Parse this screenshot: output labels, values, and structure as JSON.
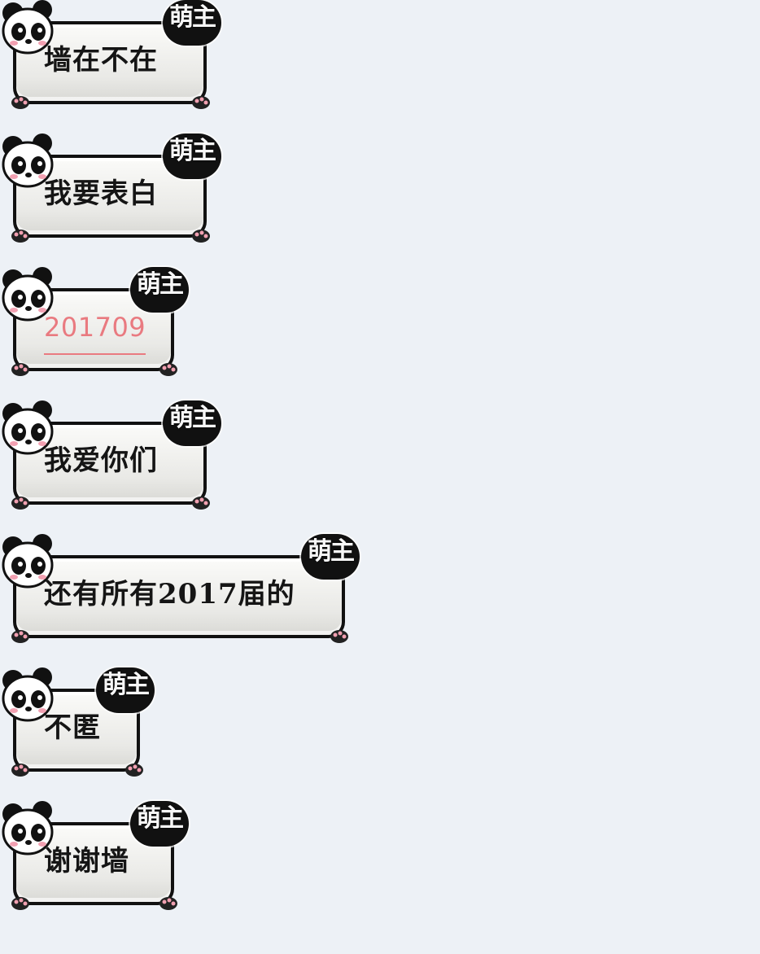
{
  "chat": {
    "badge_label": "萌主",
    "messages": [
      {
        "text": "墙在不在",
        "type": "text"
      },
      {
        "text": "我要表白",
        "type": "text"
      },
      {
        "text": "201709",
        "type": "link"
      },
      {
        "text": "我爱你们",
        "type": "text"
      },
      {
        "text": "还有所有2017届的",
        "type": "text"
      },
      {
        "text": "不匿",
        "type": "text"
      },
      {
        "text": "谢谢墙",
        "type": "text"
      }
    ]
  },
  "colors": {
    "background": "#edf1f6",
    "bubble_border": "#111111",
    "bubble_fill": "#f1f1ee",
    "link_text": "#e97a80",
    "badge": "#111111",
    "panda_blush": "#f2a0b1"
  },
  "icons": {
    "avatar": "panda-icon",
    "paw": "paw-icon"
  }
}
